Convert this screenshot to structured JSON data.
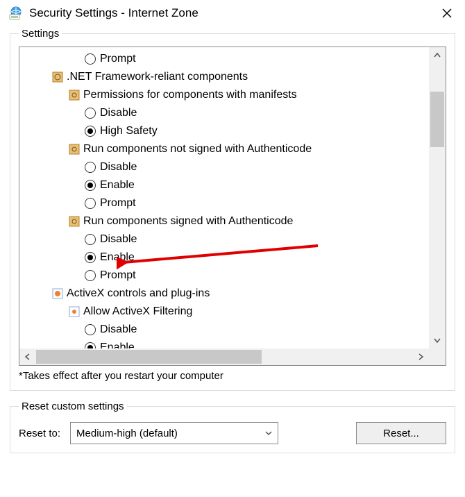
{
  "title": "Security Settings - Internet Zone",
  "settings_legend": "Settings",
  "tree": {
    "r0": "Prompt",
    "g0": ".NET Framework-reliant components",
    "g0a": "Permissions for components with manifests",
    "g0a_o1": "Disable",
    "g0a_o2": "High Safety",
    "g0b": "Run components not signed with Authenticode",
    "g0b_o1": "Disable",
    "g0b_o2": "Enable",
    "g0b_o3": "Prompt",
    "g0c": "Run components signed with Authenticode",
    "g0c_o1": "Disable",
    "g0c_o2": "Enable",
    "g0c_o3": "Prompt",
    "g1": "ActiveX controls and plug-ins",
    "g1a": "Allow ActiveX Filtering",
    "g1a_o1": "Disable",
    "g1a_o2": "Enable"
  },
  "note": "*Takes effect after you restart your computer",
  "reset": {
    "legend": "Reset custom settings",
    "label": "Reset to:",
    "value": "Medium-high (default)",
    "button": "Reset..."
  }
}
